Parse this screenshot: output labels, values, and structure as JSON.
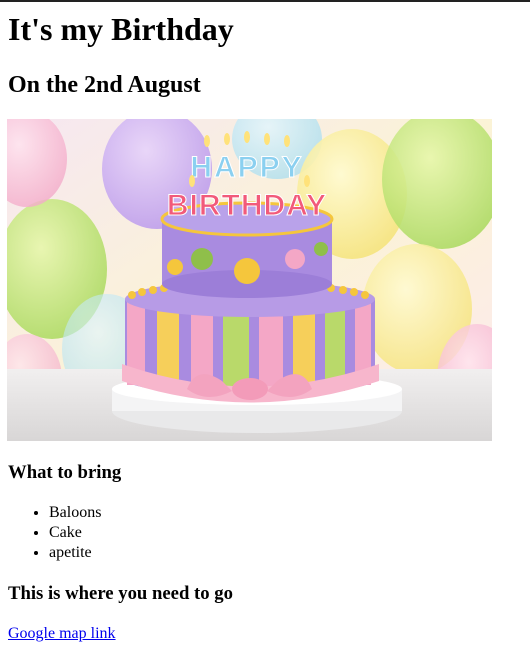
{
  "heading": "It's my Birthday",
  "subheading": "On the 2nd August",
  "image": {
    "cake_topper_line1": "HAPPY",
    "cake_topper_line2": "BIRTHDAY",
    "colors": {
      "cake_purple": "#a98be0",
      "stripe_pink": "#f4a7c6",
      "stripe_green": "#b9d96a",
      "stripe_yellow": "#f6cf5a",
      "ribbon_pink": "#f7b6cc",
      "dot_green": "#8fbf4a",
      "dot_yellow": "#f5c63c"
    }
  },
  "bring": {
    "title": "What to bring",
    "items": [
      "Baloons",
      "Cake",
      "apetite"
    ]
  },
  "where": {
    "title": "This is where you need to go",
    "link_label": "Google map link"
  }
}
